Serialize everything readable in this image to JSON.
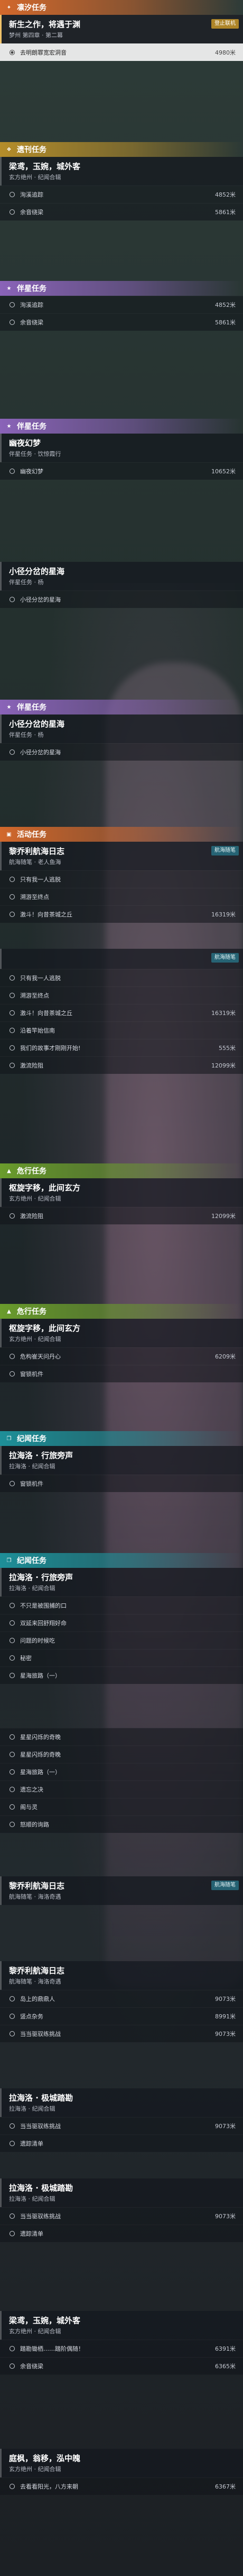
{
  "colors": {
    "orange": "#d2682c",
    "purple": "#8a63b8",
    "teal": "#1e8f98",
    "green": "#6a9c2c",
    "gold": "#b58d2a",
    "blue": "#3d6fb8",
    "active": "#f0c36a"
  },
  "sections": [
    {
      "category": "凛汐任务",
      "icon": "flame-icon",
      "quest": {
        "title": "新生之作，将遇于渊",
        "subtitle": "梦州 第四章 · 第二幕",
        "badge": "登止联机"
      },
      "objectives": [
        {
          "text": "去明朗罪宽宏洞音",
          "dist": "4980米",
          "selected": true
        }
      ]
    },
    {
      "category": "遗刊任务",
      "icon": "scroll-icon",
      "quest": {
        "title": "梁鸢，玉婉，城外客",
        "subtitle": "玄方绝州 · 纪闻合辑"
      },
      "objectives": [
        {
          "text": "洵溪追踪",
          "dist": "4852米"
        },
        {
          "text": "余音绕梁",
          "dist": "5861米"
        }
      ]
    },
    {
      "category": "伴星任务",
      "icon": "star-icon",
      "quest": null,
      "objectives": [
        {
          "text": "洵溪追踪",
          "dist": "4852米"
        },
        {
          "text": "余音绕梁",
          "dist": "5861米"
        }
      ]
    },
    {
      "category": "伴星任务",
      "icon": "star-icon",
      "quest": {
        "title": "幽夜幻梦",
        "subtitle": "伴星任务 · 饮惊霞行"
      },
      "objectives": [
        {
          "text": "幽夜幻梦",
          "dist": "10652米"
        }
      ]
    },
    {
      "category": "",
      "icon": "",
      "quest": {
        "title": "小径分岔的星海",
        "subtitle": "伴星任务 · 杨"
      },
      "objectives": [
        {
          "text": "小径分岔的星海",
          "dist": ""
        }
      ]
    },
    {
      "category": "伴星任务",
      "icon": "star-icon",
      "quest": {
        "title": "小径分岔的星海",
        "subtitle": "伴星任务 · 杨"
      },
      "objectives": [
        {
          "text": "小径分岔的星海",
          "dist": ""
        }
      ]
    },
    {
      "category": "活动任务",
      "icon": "calendar-icon",
      "quest": {
        "title": "黎乔利航海日志",
        "subtitle": "航海随笔 · 老人鱼海",
        "badge": "航海随笔"
      },
      "objectives": [
        {
          "text": "只有我一人逃脱",
          "dist": ""
        },
        {
          "text": "溯游至终点",
          "dist": ""
        },
        {
          "text": "激斗！向昔茶城之丘",
          "dist": "16319米"
        }
      ]
    },
    {
      "category": "",
      "icon": "",
      "quest": null,
      "badgeOnly": "航海随笔",
      "objectives": [
        {
          "text": "只有我一人逃脱",
          "dist": ""
        },
        {
          "text": "溯游至终点",
          "dist": ""
        },
        {
          "text": "激斗！向昔茶城之丘",
          "dist": "16319米"
        },
        {
          "text": "沿着竿始信南",
          "dist": ""
        },
        {
          "text": "我们的故事才刚刚开始!",
          "dist": "555米"
        },
        {
          "text": "激流险阻",
          "dist": "12099米"
        }
      ]
    },
    {
      "category": "危行任务",
      "icon": "warning-icon",
      "quest": {
        "title": "枢旋字移，此间玄方",
        "subtitle": "玄方绝州 · 纪闻合辑"
      },
      "objectives": [
        {
          "text": "激流险阻",
          "dist": "12099米"
        }
      ]
    },
    {
      "category": "危行任务",
      "icon": "warning-icon",
      "quest": {
        "title": "枢旋字移，此间玄方",
        "subtitle": "玄方绝州 · 纪闻合辑"
      },
      "objectives": [
        {
          "text": "危构崔天问丹心",
          "dist": "6209米"
        },
        {
          "text": "窗锁机件",
          "dist": ""
        }
      ]
    },
    {
      "category": "纪闻任务",
      "icon": "book-icon",
      "quest": {
        "title": "拉海洛 · 行旅旁声",
        "subtitle": "拉海洛 · 纪闻合辑"
      },
      "objectives": [
        {
          "text": "窗锁机件",
          "dist": ""
        }
      ]
    },
    {
      "category": "纪闻任务",
      "icon": "book-icon",
      "quest": {
        "title": "拉海洛 · 行旅旁声",
        "subtitle": "拉海洛 · 纪闻合辑"
      },
      "objectives": [
        {
          "text": "不只是被围捕的口",
          "dist": ""
        },
        {
          "text": "双延来回舒翔好命",
          "dist": ""
        },
        {
          "text": "问题的时候吃",
          "dist": ""
        },
        {
          "text": "秘密",
          "dist": ""
        },
        {
          "text": "星海旅路（一）",
          "dist": ""
        }
      ]
    },
    {
      "category": "",
      "icon": "",
      "quest": null,
      "objectives": [
        {
          "text": "星星闪烁的奇晚",
          "dist": ""
        },
        {
          "text": "星星闪烁的奇晚",
          "dist": ""
        },
        {
          "text": "星海旅路（一）",
          "dist": ""
        },
        {
          "text": "遗忘之决",
          "dist": ""
        },
        {
          "text": "阁与灵",
          "dist": ""
        },
        {
          "text": "怒顺的询路",
          "dist": ""
        }
      ]
    },
    {
      "category": "",
      "icon": "",
      "quest": {
        "title": "黎乔利航海日志",
        "subtitle": "航海随笔 · 海洛奇遇",
        "badge": "航海随笔"
      },
      "objectives": []
    },
    {
      "category": "",
      "icon": "",
      "quest": {
        "title": "黎乔利航海日志",
        "subtitle": "航海随笔 · 海洛奇遇"
      },
      "objectives": [
        {
          "text": "岛上的鼎鼎人",
          "dist": "9073米"
        },
        {
          "text": "竖点杂务",
          "dist": "8991米"
        },
        {
          "text": "当当驱驭练挑战",
          "dist": "9073米"
        }
      ]
    },
    {
      "category": "",
      "icon": "",
      "quest": {
        "title": "拉海洛 · 极城踏勘",
        "subtitle": "拉海洛 · 纪闻合辑"
      },
      "objectives": [
        {
          "text": "当当驱驭练挑战",
          "dist": "9073米"
        },
        {
          "text": "遗踪清单",
          "dist": ""
        }
      ]
    },
    {
      "category": "",
      "icon": "",
      "quest": {
        "title": "拉海洛 · 极城踏勘",
        "subtitle": "拉海洛 · 纪闻合辑"
      },
      "objectives": [
        {
          "text": "当当驱驭练挑战",
          "dist": "9073米"
        },
        {
          "text": "遗踪清单",
          "dist": ""
        }
      ]
    },
    {
      "category": "",
      "icon": "",
      "quest": {
        "title": "梁鸢，玉婉，城外客",
        "subtitle": "玄方绝州 · 纪闻合辑"
      },
      "objectives": [
        {
          "text": "踏勘锄栖……踏阶偶随！",
          "dist": "6391米"
        },
        {
          "text": "余音绕梁",
          "dist": "6365米"
        }
      ]
    },
    {
      "category": "",
      "icon": "",
      "quest": {
        "title": "庭枫，翁移，泓中魄",
        "subtitle": "玄方绝州 · 纪闻合辑"
      },
      "objectives": [
        {
          "text": "去看看阳光，八方来朝",
          "dist": "6367米"
        }
      ]
    }
  ]
}
